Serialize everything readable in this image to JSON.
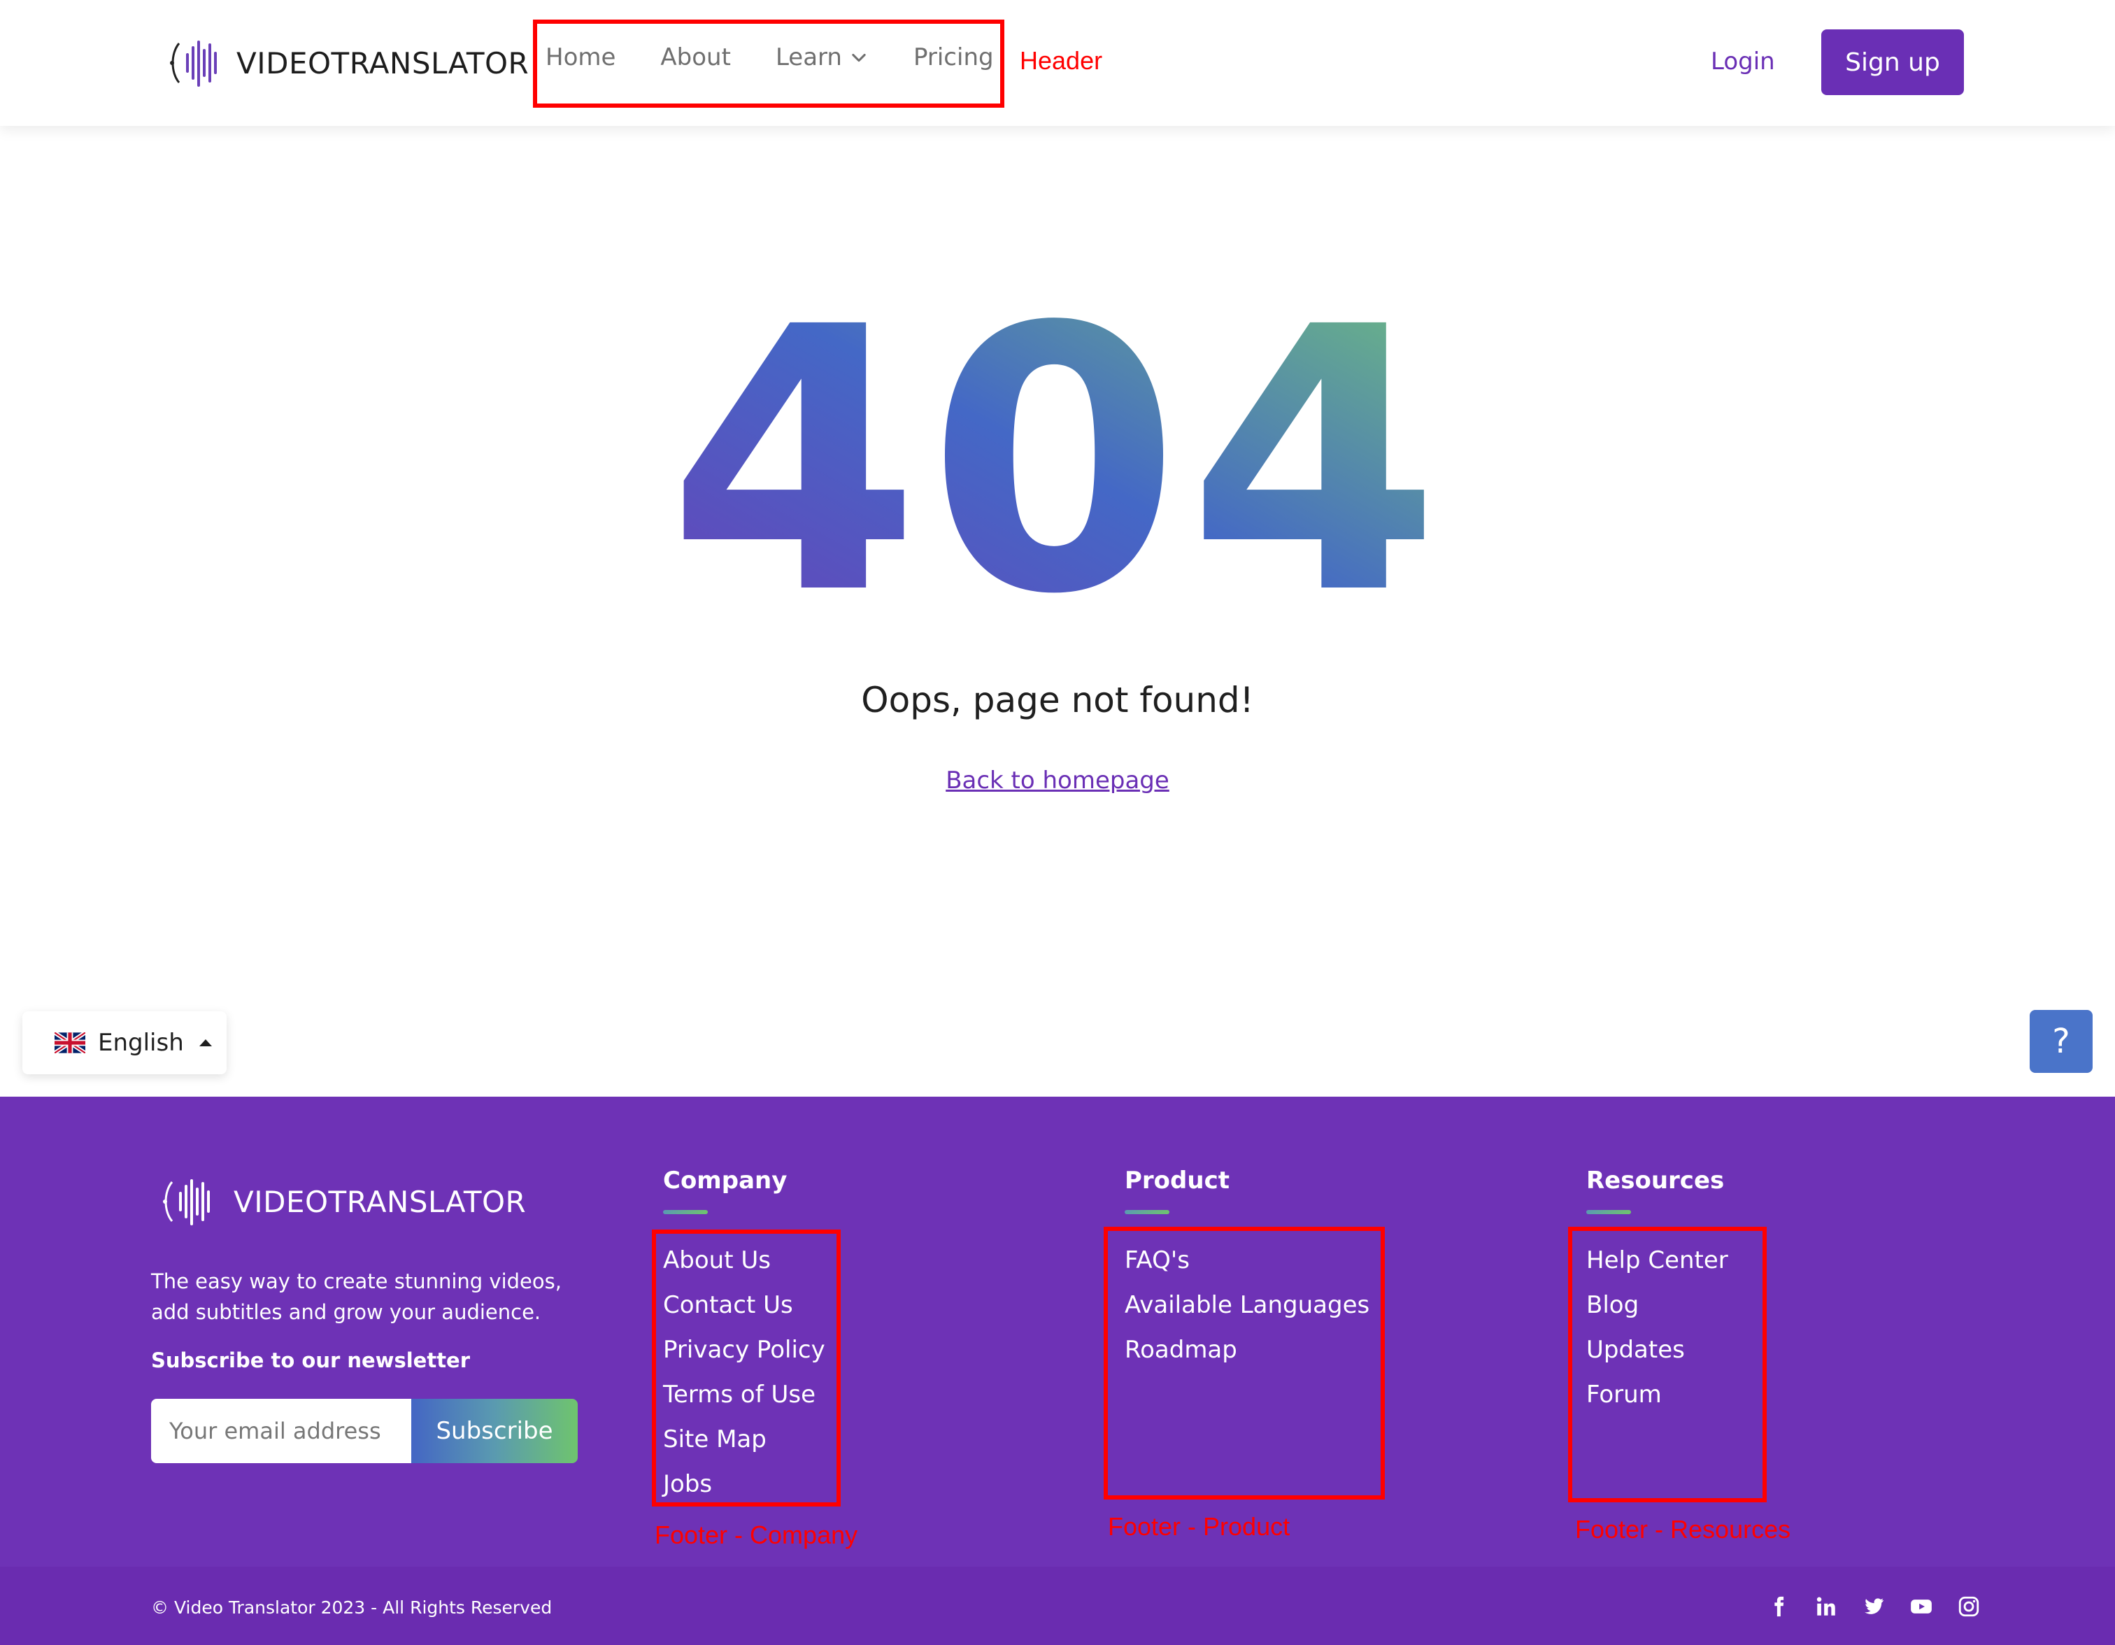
{
  "header": {
    "brand": "VIDEOTRANSLATOR",
    "nav": [
      {
        "label": "Home"
      },
      {
        "label": "About"
      },
      {
        "label": "Learn"
      },
      {
        "label": "Pricing"
      }
    ],
    "login_label": "Login",
    "signup_label": "Sign up",
    "annotation": "Header"
  },
  "main": {
    "code": "404",
    "message": "Oops, page not found!",
    "back_link": "Back to homepage"
  },
  "language_selector": {
    "current": "English",
    "icon": "uk-flag-icon"
  },
  "help_button": {
    "label": "?"
  },
  "footer": {
    "brand": "VIDEOTRANSLATOR",
    "tagline": "The easy way to create stunning videos, add subtitles and grow your audience.",
    "newsletter_title": "Subscribe to our newsletter",
    "email_placeholder": "Your email address",
    "subscribe_label": "Subscribe",
    "columns": [
      {
        "title": "Company",
        "items": [
          "About Us",
          "Contact Us",
          "Privacy Policy",
          "Terms of Use",
          "Site Map",
          "Jobs"
        ],
        "annotation": "Footer - Company"
      },
      {
        "title": "Product",
        "items": [
          "FAQ's",
          "Available Languages",
          "Roadmap"
        ],
        "annotation": "Footer - Product"
      },
      {
        "title": "Resources",
        "items": [
          "Help Center",
          "Blog",
          "Updates",
          "Forum"
        ],
        "annotation": "Footer - Resources"
      }
    ],
    "copyright": "© Video Translator 2023 - All Rights Reserved",
    "socials": [
      "facebook-icon",
      "linkedin-icon",
      "twitter-icon",
      "youtube-icon",
      "instagram-icon"
    ]
  },
  "colors": {
    "brand_purple": "#6e32b6",
    "gradient_start": "#6a3fb8",
    "gradient_mid": "#4468c6",
    "gradient_end": "#72c47a",
    "annotation_red": "#ff0000",
    "help_blue": "#4a74c9"
  }
}
